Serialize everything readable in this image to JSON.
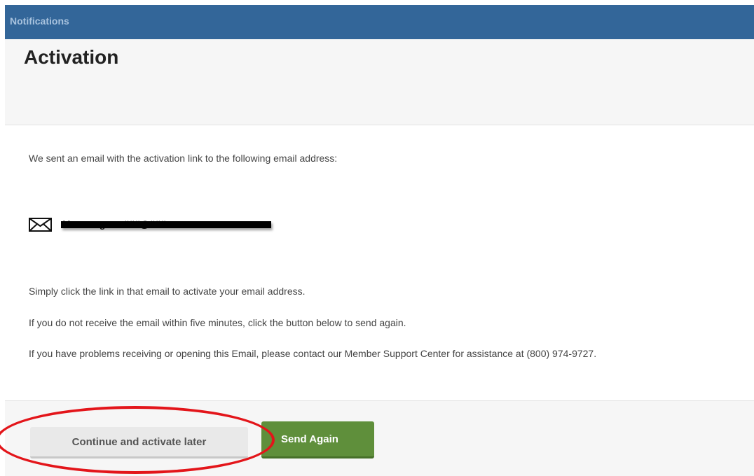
{
  "topbar": {
    "title": "Notifications"
  },
  "header": {
    "title": "Activation"
  },
  "main": {
    "intro": "We sent an email with the activation link to the following email address:",
    "email": {
      "icon": "envelope-icon",
      "address": "Mammogram###@###.com"
    },
    "paragraphs": [
      "Simply click the link in that email to activate your email address.",
      "If you do not receive the email within five minutes, click the button below to send again.",
      "If you have problems receiving or opening this Email, please contact our Member Support Center for assistance at (800) 974-9727."
    ]
  },
  "footer": {
    "continue_label": "Continue and activate later",
    "send_again_label": "Send Again"
  },
  "colors": {
    "topbar": "#336699",
    "send_button": "#5f8f3b",
    "annotation": "#e3151a"
  }
}
